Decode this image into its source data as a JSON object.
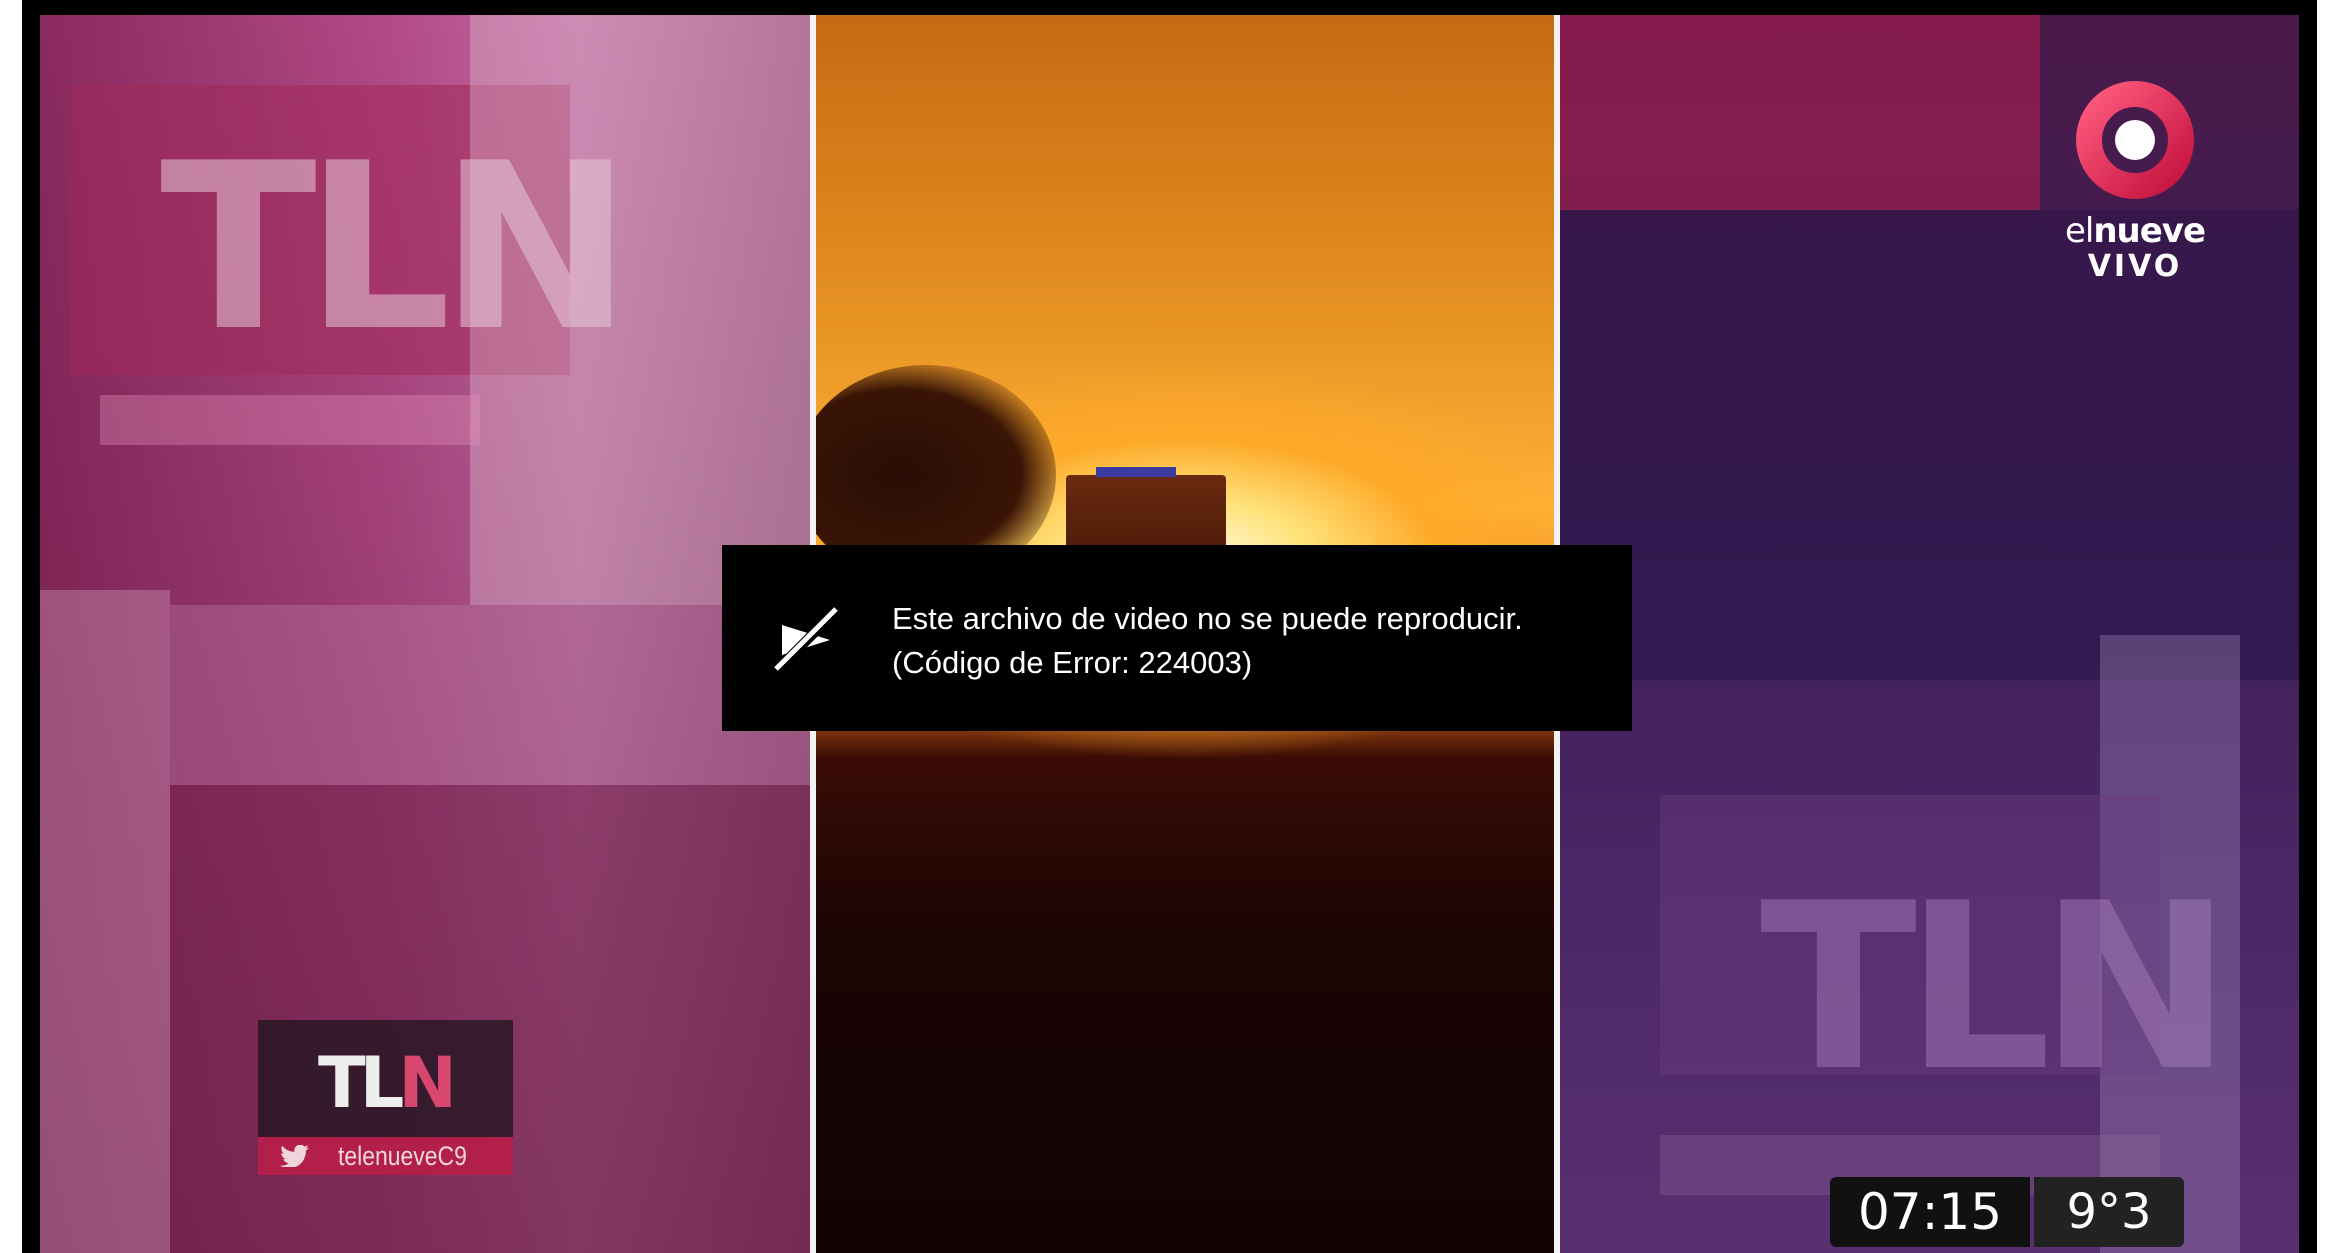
{
  "error": {
    "line1": "Este archivo de video no se puede reproducir.",
    "line2": "(Código de Error: 224003)",
    "icon": "broken-video-icon"
  },
  "channel": {
    "name_light": "el",
    "name_bold": "nueve",
    "live_label": "VIVO",
    "brand_color": "#e0245e"
  },
  "program_badge": {
    "logo_text_a": "TL",
    "logo_text_b": "N",
    "social_icon": "twitter-icon",
    "handle": "telenueveC9"
  },
  "ticker": {
    "time": "07:15",
    "temperature": "9°3"
  },
  "background": {
    "ghost_logo": "TLN"
  }
}
